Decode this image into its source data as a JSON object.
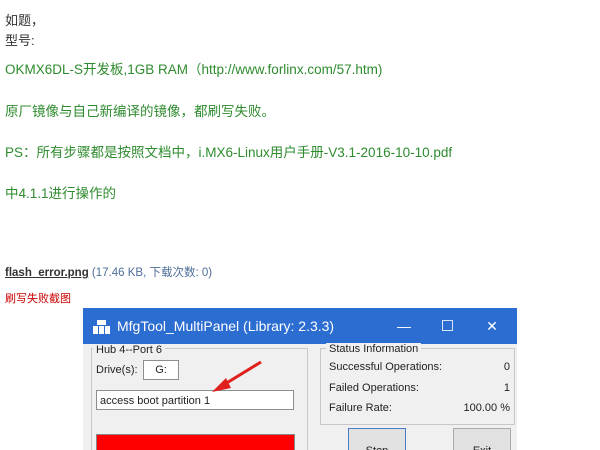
{
  "post": {
    "lines": [
      "如题，",
      "型号:",
      "OKMX6DL-S开发板,1GB RAM（http://www.forlinx.com/57.htm)",
      "原厂镜像与自己新编译的镜像，都刷写失败。",
      "PS：所有步骤都是按照文档中，i.MX6-Linux用户手册-V3.1-2016-10-10.pdf",
      "中4.1.1进行操作的"
    ],
    "colors": {
      "body_text": "#333333",
      "green_text": "#2e8b2e",
      "caption": "#cc0000"
    }
  },
  "attachment": {
    "filename": "flash_error.png",
    "meta": "(17.46 KB, 下载次数: 0)",
    "caption": "刷写失败截图"
  },
  "screenshot": {
    "window_title": "MfgTool_MultiPanel (Library: 2.3.3)",
    "title_color": "#2c6dd1",
    "hub_label": "Hub 4--Port 6",
    "drive_label": "Drive(s):",
    "drive_value": "G:",
    "status_message": "access boot partition 1",
    "progress_color": "#ff0000",
    "status_group_label": "Status Information",
    "stats": [
      {
        "label": "Successful Operations:",
        "value": "0"
      },
      {
        "label": "Failed Operations:",
        "value": "1"
      },
      {
        "label": "Failure Rate:",
        "value": "100.00 %"
      }
    ],
    "buttons": {
      "stop": "Stop",
      "exit": "Exit"
    },
    "window_controls": {
      "minimize": "—",
      "close": "✕"
    }
  }
}
